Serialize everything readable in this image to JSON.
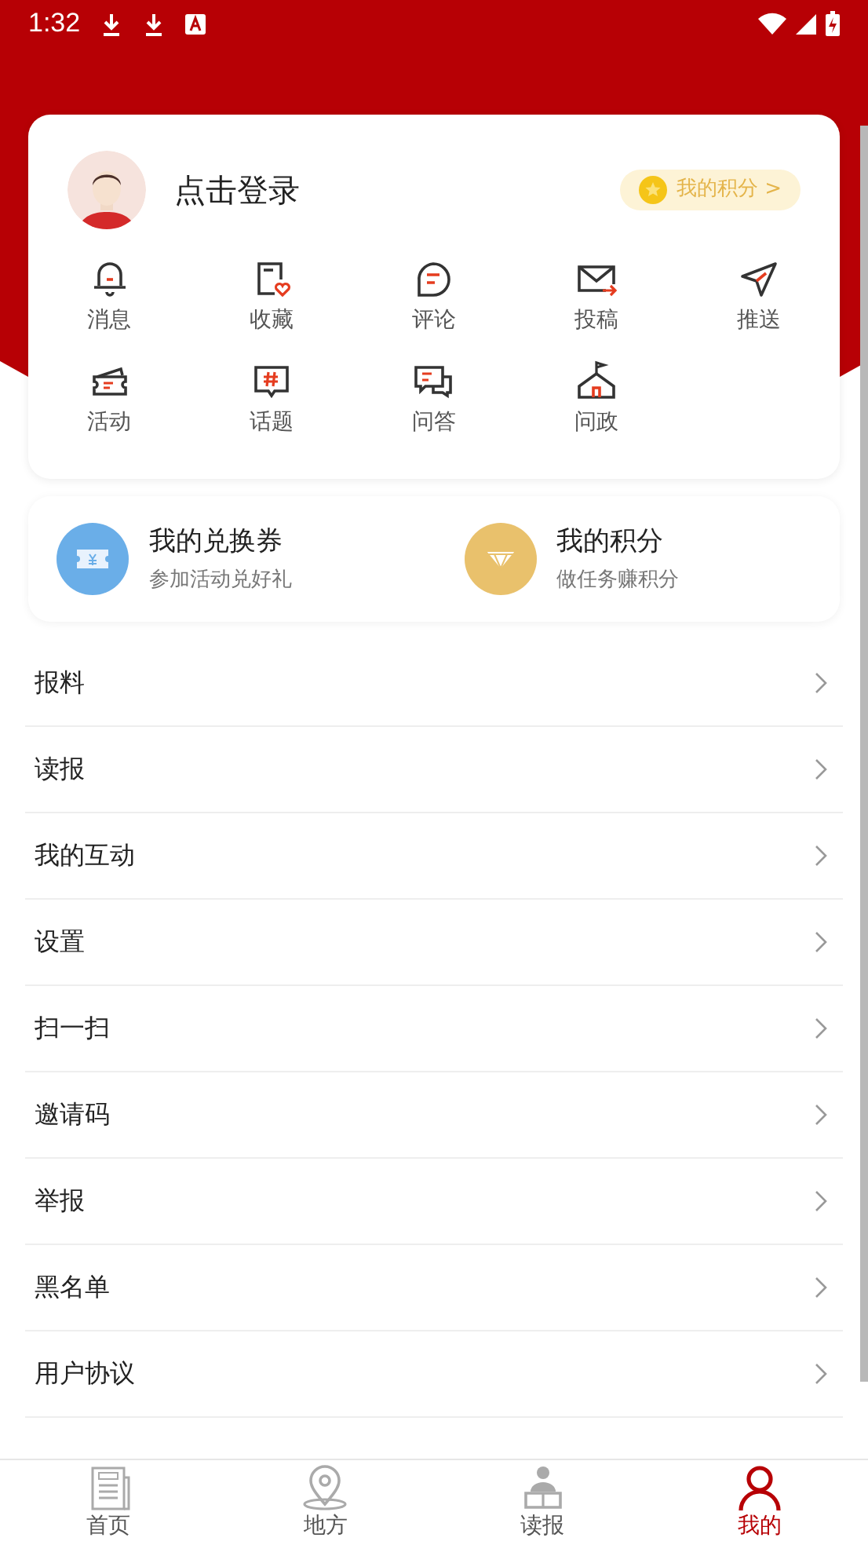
{
  "status_bar": {
    "time": "1:32"
  },
  "profile": {
    "login_label": "点击登录",
    "points_button": "我的积分 >"
  },
  "shortcuts": [
    {
      "label": "消息",
      "kind": "bell"
    },
    {
      "label": "收藏",
      "kind": "doc-heart"
    },
    {
      "label": "评论",
      "kind": "bubble"
    },
    {
      "label": "投稿",
      "kind": "mail"
    },
    {
      "label": "推送",
      "kind": "send"
    },
    {
      "label": "活动",
      "kind": "ticket"
    },
    {
      "label": "话题",
      "kind": "hash"
    },
    {
      "label": "问答",
      "kind": "chats"
    },
    {
      "label": "问政",
      "kind": "house"
    }
  ],
  "wallet": [
    {
      "title": "我的兑换券",
      "subtitle": "参加活动兑好礼",
      "kind": "coupon",
      "color": "#6aaee8"
    },
    {
      "title": "我的积分",
      "subtitle": "做任务赚积分",
      "kind": "diamond",
      "color": "#e9c16c"
    }
  ],
  "menu": [
    "报料",
    "读报",
    "我的互动",
    "设置",
    "扫一扫",
    "邀请码",
    "举报",
    "黑名单",
    "用户协议"
  ],
  "tab_bar": [
    {
      "label": "首页",
      "kind": "news",
      "selected": false
    },
    {
      "label": "地方",
      "kind": "pin",
      "selected": false
    },
    {
      "label": "读报",
      "kind": "reader",
      "selected": false
    },
    {
      "label": "我的",
      "kind": "person",
      "selected": true
    }
  ]
}
